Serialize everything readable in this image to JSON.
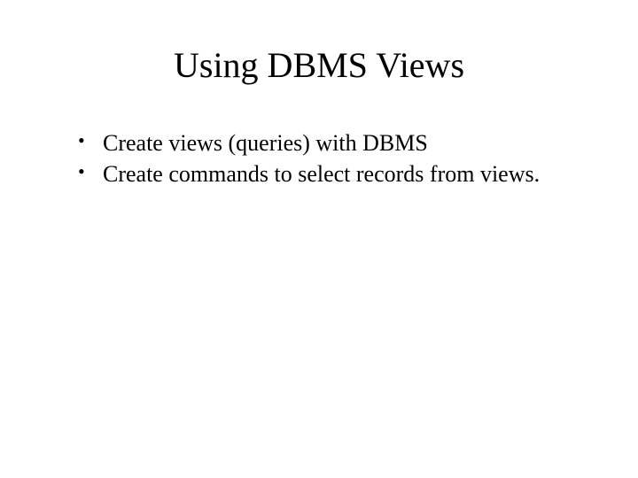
{
  "slide": {
    "title": "Using DBMS Views",
    "bullets": [
      "Create views (queries) with DBMS",
      "Create commands to select records from views."
    ]
  }
}
